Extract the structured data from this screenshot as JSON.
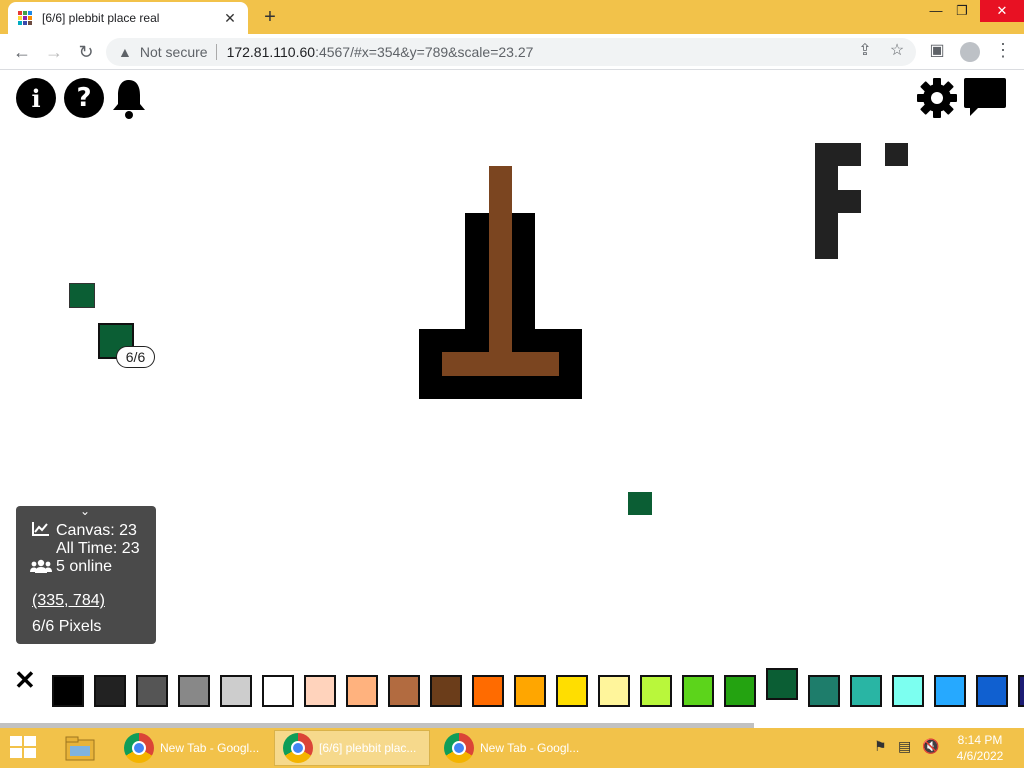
{
  "browser": {
    "tab_title": "[6/6] plebbit place real",
    "tab_close": "✕",
    "new_tab": "+",
    "security_label": "Not secure",
    "url_host": "172.81.110.60",
    "url_rest": ":4567/#x=354&y=789&scale=23.27",
    "window_controls": [
      "—",
      "❐",
      "✕"
    ]
  },
  "toolbar_icons": {
    "info": "i",
    "help": "?",
    "bell": "bell-icon",
    "settings": "gear-icon",
    "chat": "chat-icon"
  },
  "pixel_tooltip": "6/6",
  "stats": {
    "canvas_label": "Canvas: 23",
    "alltime_label": "All Time: 23",
    "online_label": "5 online",
    "coords": "(335, 784)",
    "pixels": "6/6 Pixels"
  },
  "palette": {
    "close": "✕",
    "colors": [
      "#000000",
      "#222222",
      "#555555",
      "#888888",
      "#cdcdcd",
      "#ffffff",
      "#ffd3bc",
      "#ffb27e",
      "#b26b40",
      "#6b3d1a",
      "#ff6b00",
      "#ffa600",
      "#ffde00",
      "#fff59b",
      "#b9f73b",
      "#5cd41b",
      "#24a311",
      "#0b5e34",
      "#1e7d6b",
      "#29b5a4",
      "#7cfff0",
      "#26a9ff",
      "#1060d0",
      "#1c1c74"
    ],
    "selected_index": 17
  },
  "colors": {
    "titlebar": "#f2c24a",
    "pixel_dark_green": "#0b5e34",
    "pixel_brown": "#7b4520",
    "pixel_black": "#000000",
    "pixel_charcoal": "#222222"
  },
  "taskbar": {
    "items": [
      {
        "label": "New Tab - Googl..."
      },
      {
        "label": "[6/6] plebbit plac..."
      },
      {
        "label": "New Tab - Googl..."
      }
    ],
    "time": "8:14 PM",
    "date": "4/6/2022"
  }
}
